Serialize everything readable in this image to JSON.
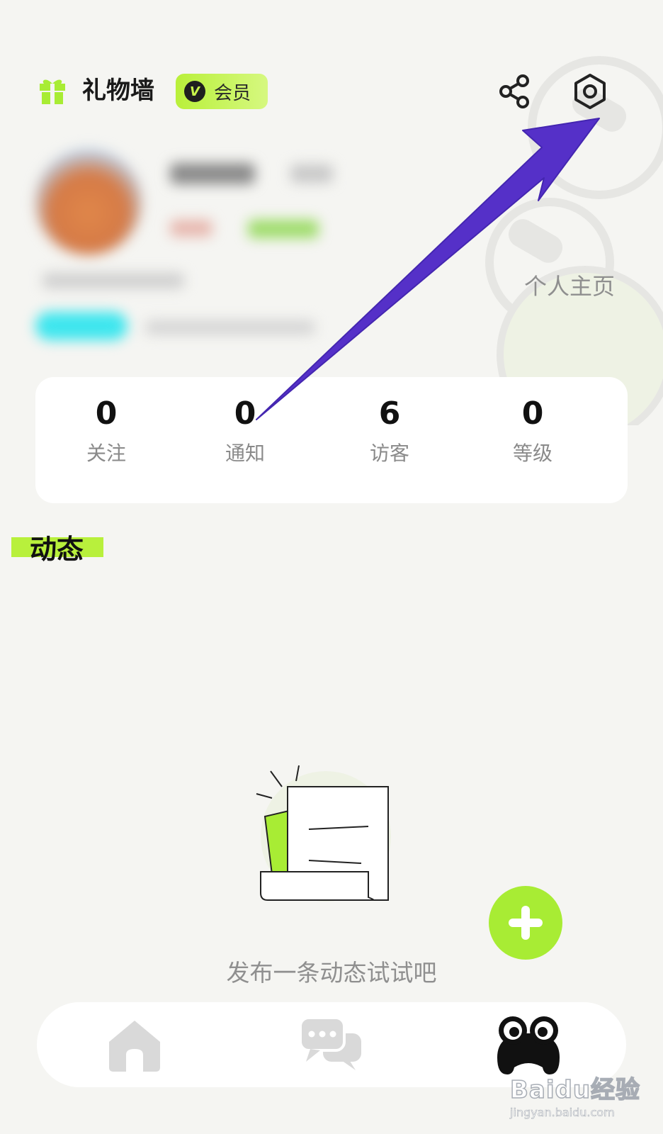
{
  "header": {
    "gift_wall_label": "礼物墙",
    "vip_badge_letter": "V",
    "vip_badge_label": "会员"
  },
  "profile": {
    "homepage_link": "个人主页"
  },
  "stats": [
    {
      "value": "0",
      "label": "关注"
    },
    {
      "value": "0",
      "label": "通知"
    },
    {
      "value": "6",
      "label": "访客"
    },
    {
      "value": "0",
      "label": "等级"
    }
  ],
  "feed": {
    "title": "动态",
    "empty_text": "发布一条动态试试吧"
  },
  "bottom_nav": {
    "items": [
      {
        "icon": "home-icon",
        "active": false
      },
      {
        "icon": "chat-icon",
        "active": false
      },
      {
        "icon": "frog-profile-icon",
        "active": true
      }
    ]
  },
  "colors": {
    "accent_green": "#a8ec34",
    "annotation_arrow": "#5530c8"
  },
  "watermark": {
    "brand": "Baidu经验",
    "url": "jingyan.baidu.com"
  }
}
